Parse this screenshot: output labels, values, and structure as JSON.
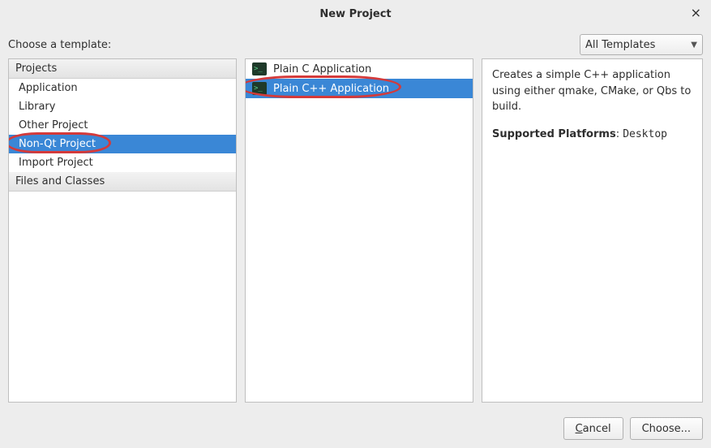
{
  "titlebar": {
    "title": "New Project"
  },
  "toprow": {
    "label": "Choose a template:",
    "filter": "All Templates"
  },
  "left": {
    "sections": [
      {
        "header": "Projects",
        "items": [
          {
            "label": "Application",
            "selected": false
          },
          {
            "label": "Library",
            "selected": false
          },
          {
            "label": "Other Project",
            "selected": false
          },
          {
            "label": "Non-Qt Project",
            "selected": true
          },
          {
            "label": "Import Project",
            "selected": false
          }
        ]
      },
      {
        "header": "Files and Classes",
        "items": []
      }
    ]
  },
  "mid": {
    "items": [
      {
        "label": "Plain C Application",
        "selected": false
      },
      {
        "label": "Plain C++ Application",
        "selected": true
      }
    ]
  },
  "right": {
    "description": "Creates a simple C++ application using either qmake, CMake, or Qbs to build.",
    "platforms_label": "Supported Platforms",
    "platforms_value": "Desktop"
  },
  "footer": {
    "cancel": "Cancel",
    "choose": "Choose..."
  }
}
